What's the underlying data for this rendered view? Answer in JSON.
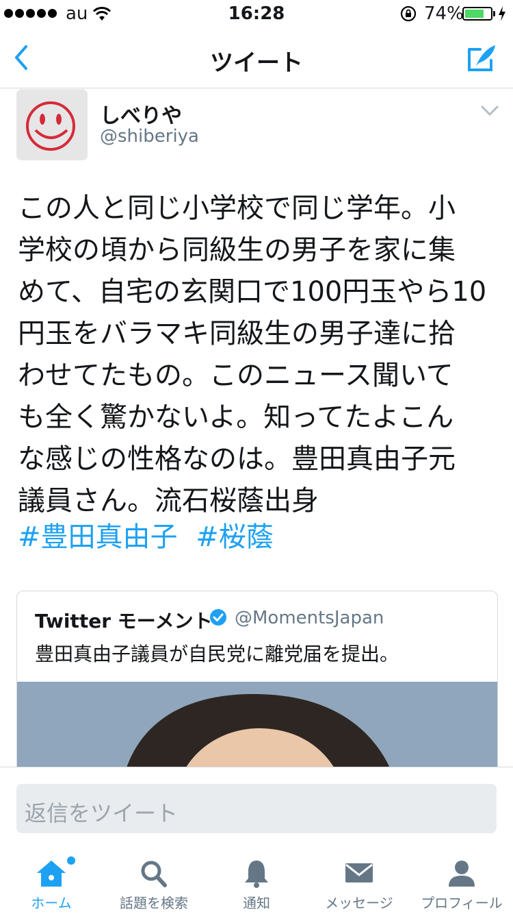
{
  "status_bar": {
    "carrier": "au",
    "time": "16:28",
    "battery": "74%",
    "battery_level": 0.74
  },
  "nav": {
    "title": "ツイート"
  },
  "tweet": {
    "name": "しべりや",
    "handle": "@shiberiya",
    "lines": [
      "この人と同じ小学校で同じ学年。小",
      "学校の頃から同級生の男子を家に集",
      "めて、自宅の玄関口で100円玉やら10",
      "円玉をバラマキ同級生の男子達に拾",
      "わせてたもの。このニュース聞いて",
      "も全く驚かないよ。知ってたよこん",
      "な感じの性格なのは。豊田真由子元",
      "議員さん。流石桜蔭出身"
    ],
    "hashtags": [
      "#豊田真由子",
      "#桜蔭"
    ]
  },
  "quote": {
    "name": "Twitter モーメント",
    "handle": "@MomentsJapan",
    "text": "豊田真由子議員が自民党に離党届を提出。"
  },
  "reply": {
    "placeholder": "返信をツイート"
  },
  "tabs": [
    {
      "label": "ホーム",
      "icon": "home-icon"
    },
    {
      "label": "話題を検索",
      "icon": "search-icon"
    },
    {
      "label": "通知",
      "icon": "bell-icon"
    },
    {
      "label": "メッセージ",
      "icon": "envelope-icon"
    },
    {
      "label": "プロフィール",
      "icon": "person-icon"
    }
  ],
  "colors": {
    "accent": "#1da1f2",
    "muted": "#657786",
    "battery": "#4cd964"
  }
}
